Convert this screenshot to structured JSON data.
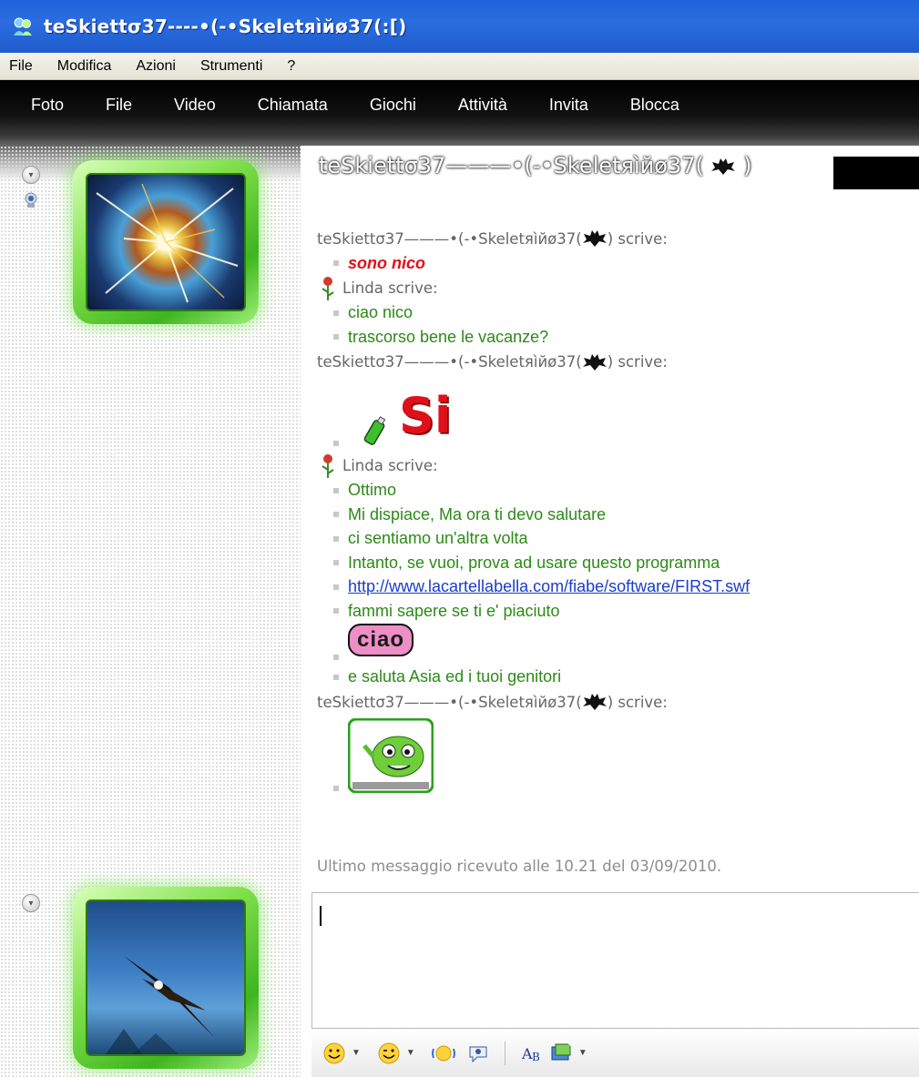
{
  "window": {
    "title": "teSkiettσ37----•(-•Skeletяìйø37(:[)"
  },
  "menubar": [
    "File",
    "Modifica",
    "Azioni",
    "Strumenti",
    "?"
  ],
  "toolbar": [
    "Foto",
    "File",
    "Video",
    "Chiamata",
    "Giochi",
    "Attività",
    "Invita",
    "Blocca"
  ],
  "contact": {
    "header_name": "teSkiettσ37———•(-•Skeletяìйø37(",
    "header_close": ")"
  },
  "conversation": {
    "sender_me_prefix": "teSkiettσ37———•(-•Skeletяìйø37(",
    "sender_me_suffix": ") scrive:",
    "sender_linda": "Linda scrive:",
    "messages": {
      "m1": "sono nico",
      "m2": "ciao nico",
      "m3": "trascorso bene le vacanze?",
      "m4_text": "Si",
      "m5": "Ottimo",
      "m6": "Mi dispiace, Ma ora ti devo salutare",
      "m7": "ci sentiamo un'altra volta",
      "m8": "Intanto, se vuoi, prova ad usare questo programma",
      "m9": "http://www.lacartellabella.com/fiabe/software/FIRST.swf",
      "m10": "fammi sapere se ti e' piaciuto",
      "m11_text": "ciao",
      "m12": "e saluta Asia ed i tuoi genitori"
    },
    "status": "Ultimo messaggio ricevuto alle 10.21 del 03/09/2010."
  },
  "colors": {
    "titlebar": "#1f5ccd",
    "message_green": "#2c8a17",
    "message_red": "#e0101a",
    "link": "#1a3ccf",
    "avatar_frame": "#7fe04a"
  },
  "icons": [
    "msn-icon",
    "bat-emoticon",
    "rose-icon",
    "spray-can-icon",
    "alien-emoticon",
    "smiley-icon",
    "wink-icon",
    "nudge-icon",
    "voice-clip-icon",
    "font-icon",
    "background-icon"
  ]
}
